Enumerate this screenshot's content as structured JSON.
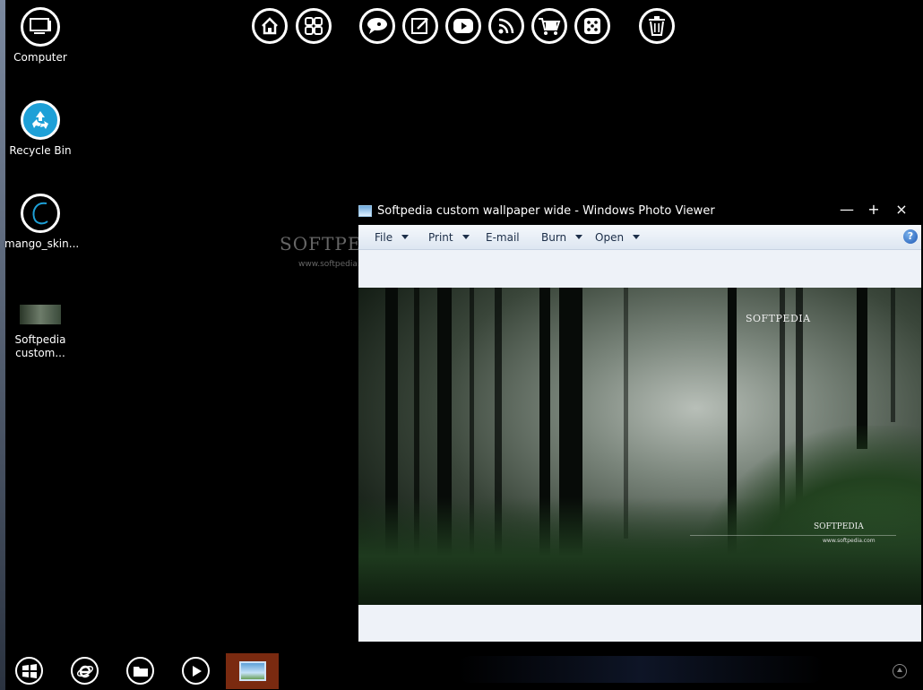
{
  "desktop": {
    "icons": [
      {
        "label": "Computer"
      },
      {
        "label": "Recycle Bin"
      },
      {
        "label": "mango_skin..."
      },
      {
        "label": "Softpedia custom..."
      }
    ]
  },
  "top_launcher": [
    {
      "icon": "home-icon"
    },
    {
      "icon": "apps-grid-icon"
    },
    {
      "icon": "speech-bubble-icon"
    },
    {
      "icon": "edit-pencil-icon"
    },
    {
      "icon": "video-play-icon"
    },
    {
      "icon": "rss-feed-icon"
    },
    {
      "icon": "shopping-cart-icon"
    },
    {
      "icon": "dice-icon"
    },
    {
      "icon": "trash-icon"
    }
  ],
  "watermark": {
    "brand": "SOFTPEDIA",
    "url": "www.softpedia.com"
  },
  "photo_viewer": {
    "title": "Softpedia custom wallpaper wide - Windows Photo Viewer",
    "window_controls": {
      "minimize": "—",
      "maximize": "+",
      "close": "×"
    },
    "menu": [
      {
        "label": "File",
        "dropdown": true
      },
      {
        "label": "Print",
        "dropdown": true
      },
      {
        "label": "E-mail",
        "dropdown": false
      },
      {
        "label": "Burn",
        "dropdown": true
      },
      {
        "label": "Open",
        "dropdown": true
      }
    ],
    "help_label": "?",
    "photo": {
      "logo_top": "SOFTPEDIA",
      "logo_bottom": "SOFTPEDIA",
      "logo_url": "www.softpedia.com"
    }
  },
  "taskbar": [
    {
      "icon": "windows-start-icon"
    },
    {
      "icon": "internet-explorer-icon"
    },
    {
      "icon": "folder-icon"
    },
    {
      "icon": "media-play-icon"
    },
    {
      "icon": "photo-viewer-icon"
    }
  ],
  "colors": {
    "background": "#000000",
    "accent": "#1ea0d7",
    "active_task": "#7a2a10",
    "menu_text": "#1c2e48"
  }
}
